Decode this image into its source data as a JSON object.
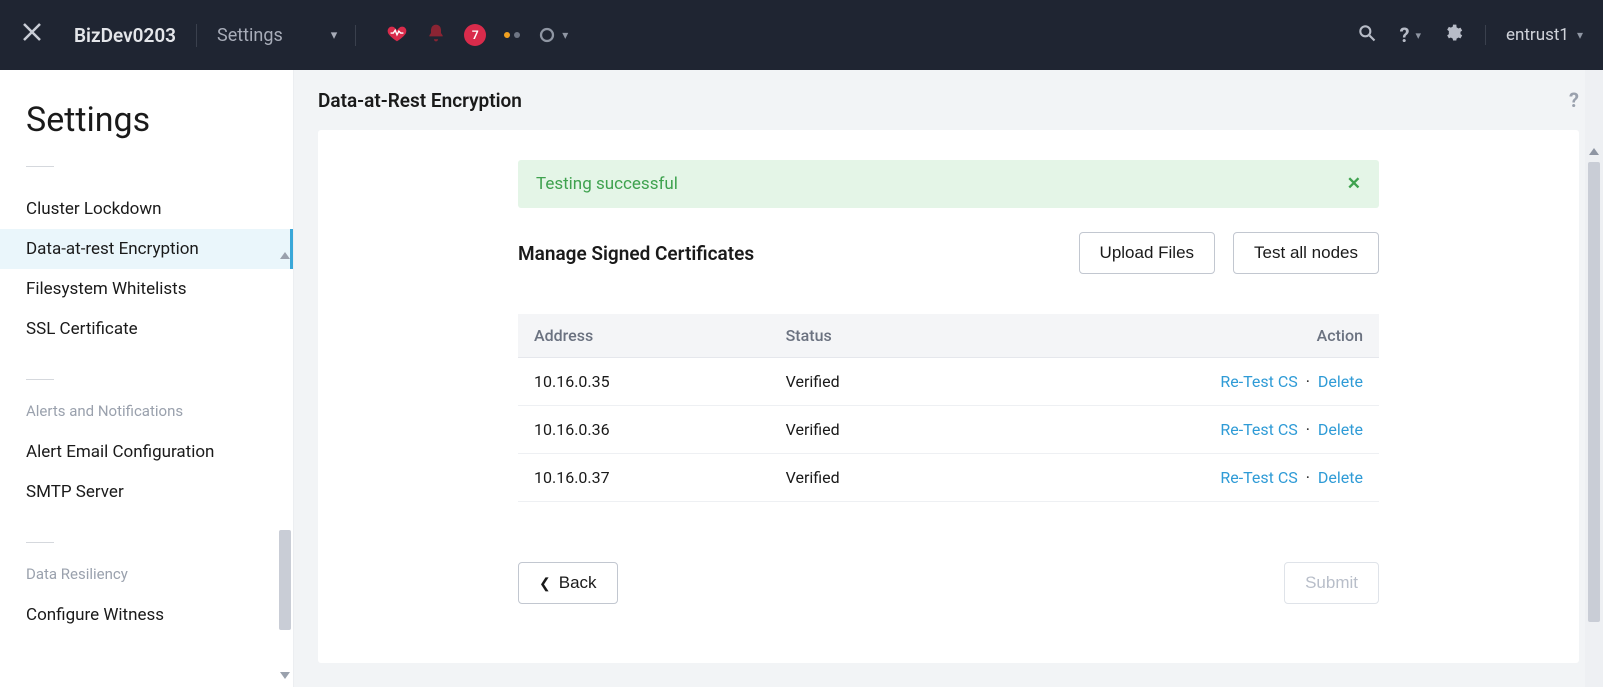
{
  "header": {
    "cluster_name": "BizDev0203",
    "context_label": "Settings",
    "notification_count": "7",
    "username": "entrust1"
  },
  "sidebar": {
    "title": "Settings",
    "groups": [
      {
        "label": "",
        "items": [
          {
            "label": "Cluster Lockdown",
            "active": false
          },
          {
            "label": "Data-at-rest Encryption",
            "active": true
          },
          {
            "label": "Filesystem Whitelists",
            "active": false
          },
          {
            "label": "SSL Certificate",
            "active": false
          }
        ]
      },
      {
        "label": "Alerts and Notifications",
        "items": [
          {
            "label": "Alert Email Configuration",
            "active": false
          },
          {
            "label": "SMTP Server",
            "active": false
          }
        ]
      },
      {
        "label": "Data Resiliency",
        "items": [
          {
            "label": "Configure Witness",
            "active": false
          }
        ]
      }
    ]
  },
  "page": {
    "title": "Data-at-Rest Encryption",
    "alert_text": "Testing successful",
    "section_title": "Manage Signed Certificates",
    "upload_btn": "Upload Files",
    "test_all_btn": "Test all nodes",
    "back_btn": "Back",
    "submit_btn": "Submit",
    "table": {
      "headers": {
        "address": "Address",
        "status": "Status",
        "action": "Action"
      },
      "action_labels": {
        "retest": "Re-Test CS",
        "delete": "Delete"
      },
      "rows": [
        {
          "address": "10.16.0.35",
          "status": "Verified"
        },
        {
          "address": "10.16.0.36",
          "status": "Verified"
        },
        {
          "address": "10.16.0.37",
          "status": "Verified"
        }
      ]
    }
  }
}
